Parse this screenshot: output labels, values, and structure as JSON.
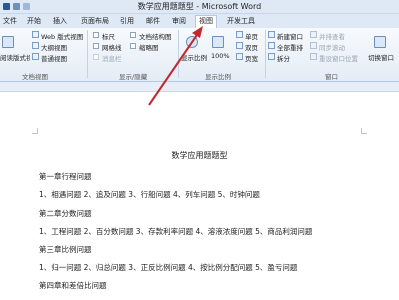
{
  "window": {
    "title": "数学应用题题型 - Microsoft Word"
  },
  "tabs": [
    {
      "label": "文件"
    },
    {
      "label": "开始"
    },
    {
      "label": "插入"
    },
    {
      "label": "页面布局"
    },
    {
      "label": "引用"
    },
    {
      "label": "邮件"
    },
    {
      "label": "审阅"
    },
    {
      "label": "视图"
    },
    {
      "label": "开发工具"
    }
  ],
  "active_tab": "视图",
  "ribbon": {
    "doc_views": {
      "label": "文档视图",
      "items": [
        "阅读版式视图",
        "Web 版式视图",
        "大纲视图",
        "普通视图"
      ]
    },
    "show": {
      "label": "显示/隐藏",
      "items": [
        "标尺",
        "网格线",
        "消息栏",
        "文档结构图",
        "缩略图"
      ]
    },
    "zoom": {
      "label": "显示比例",
      "items": [
        "显示比例",
        "100%",
        "单页",
        "双页",
        "页宽"
      ]
    },
    "window": {
      "label": "窗口",
      "items": [
        "新建窗口",
        "全部重排",
        "拆分",
        "并排查看",
        "同步滚动",
        "重设窗口位置",
        "切换窗口"
      ]
    }
  },
  "document": {
    "title": "数学应用题题型",
    "lines": [
      "第一章行程问题",
      "1、相遇问题  2、追及问题  3、行船问题  4、列车问题  5、时钟问题",
      "第二章分数问题",
      "1、工程问题  2、百分数问题  3、存款利率问题  4、溶液浓度问题  5、商品利润问题",
      "第三章比例问题",
      "1、归一问题  2、归总问题  3、正反比例问题  4、按比例分配问题  5、盈亏问题",
      "第四章和差倍比问题"
    ]
  },
  "colors": {
    "annotation_arrow": "#c0282d",
    "ribbon_bg": "#e4ecf6"
  }
}
